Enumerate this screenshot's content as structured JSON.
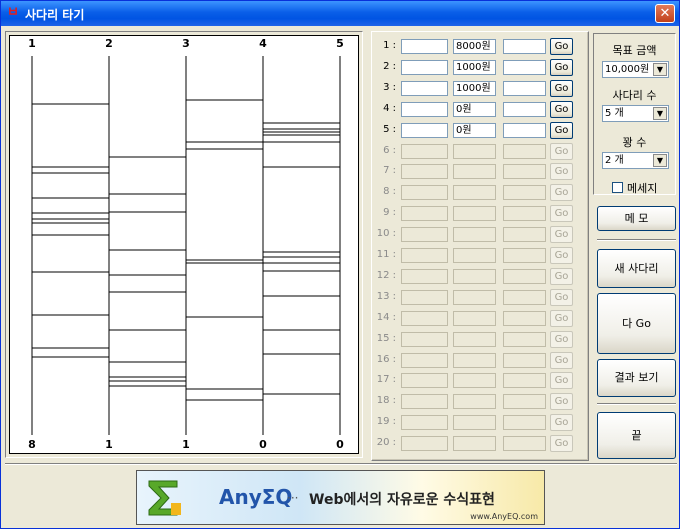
{
  "window": {
    "title": "사다리 타기",
    "title_icon": "ㅂ",
    "close_label": "✕"
  },
  "ladder": {
    "top_labels": [
      "1",
      "2",
      "3",
      "4",
      "5"
    ],
    "bottom_labels": [
      "8",
      "1",
      "1",
      "0",
      "0"
    ],
    "rungs": [
      [
        0,
        [
          102,
          165,
          171,
          196,
          211,
          217,
          221,
          233,
          270,
          313,
          346,
          355
        ]
      ],
      [
        1,
        [
          155,
          192,
          210,
          248,
          273,
          290,
          328,
          360,
          375,
          379,
          384
        ]
      ],
      [
        2,
        [
          98,
          140,
          147,
          258,
          261,
          315,
          387,
          398
        ]
      ],
      [
        3,
        [
          121,
          127,
          130,
          133,
          140,
          165,
          250,
          255,
          261,
          269,
          294,
          328,
          352,
          392
        ]
      ]
    ]
  },
  "rows": [
    {
      "num": "1 :",
      "name": "",
      "amount": "8000원",
      "result": "",
      "go": "Go",
      "enabled": true
    },
    {
      "num": "2 :",
      "name": "",
      "amount": "1000원",
      "result": "",
      "go": "Go",
      "enabled": true
    },
    {
      "num": "3 :",
      "name": "",
      "amount": "1000원",
      "result": "",
      "go": "Go",
      "enabled": true
    },
    {
      "num": "4 :",
      "name": "",
      "amount": "0원",
      "result": "",
      "go": "Go",
      "enabled": true
    },
    {
      "num": "5 :",
      "name": "",
      "amount": "0원",
      "result": "",
      "go": "Go",
      "enabled": true
    },
    {
      "num": "6 :",
      "name": "",
      "amount": "",
      "result": "",
      "go": "Go",
      "enabled": false
    },
    {
      "num": "7 :",
      "name": "",
      "amount": "",
      "result": "",
      "go": "Go",
      "enabled": false
    },
    {
      "num": "8 :",
      "name": "",
      "amount": "",
      "result": "",
      "go": "Go",
      "enabled": false
    },
    {
      "num": "9 :",
      "name": "",
      "amount": "",
      "result": "",
      "go": "Go",
      "enabled": false
    },
    {
      "num": "10 :",
      "name": "",
      "amount": "",
      "result": "",
      "go": "Go",
      "enabled": false
    },
    {
      "num": "11 :",
      "name": "",
      "amount": "",
      "result": "",
      "go": "Go",
      "enabled": false
    },
    {
      "num": "12 :",
      "name": "",
      "amount": "",
      "result": "",
      "go": "Go",
      "enabled": false
    },
    {
      "num": "13 :",
      "name": "",
      "amount": "",
      "result": "",
      "go": "Go",
      "enabled": false
    },
    {
      "num": "14 :",
      "name": "",
      "amount": "",
      "result": "",
      "go": "Go",
      "enabled": false
    },
    {
      "num": "15 :",
      "name": "",
      "amount": "",
      "result": "",
      "go": "Go",
      "enabled": false
    },
    {
      "num": "16 :",
      "name": "",
      "amount": "",
      "result": "",
      "go": "Go",
      "enabled": false
    },
    {
      "num": "17 :",
      "name": "",
      "amount": "",
      "result": "",
      "go": "Go",
      "enabled": false
    },
    {
      "num": "18 :",
      "name": "",
      "amount": "",
      "result": "",
      "go": "Go",
      "enabled": false
    },
    {
      "num": "19 :",
      "name": "",
      "amount": "",
      "result": "",
      "go": "Go",
      "enabled": false
    },
    {
      "num": "20 :",
      "name": "",
      "amount": "",
      "result": "",
      "go": "Go",
      "enabled": false
    }
  ],
  "settings": {
    "target_label": "목표 금액",
    "target_value": "10,000원",
    "ladder_count_label": "사다리 수",
    "ladder_count_value": "5 개",
    "blank_label": "꽝 수",
    "blank_value": "2 개",
    "hide_label": "메세지",
    "hide_checked": false
  },
  "buttons": {
    "memo": "메 모",
    "new_ladder": "새 사다리",
    "all_go": "다 Go",
    "show_result": "결과 보기",
    "end": "끝"
  },
  "banner": {
    "brand": "AnyΣQ",
    "dots": "···",
    "text": "Web에서의 자유로운 수식표현",
    "url": "www.AnyEQ.com"
  },
  "colors": {
    "titlebar": "#0054e3",
    "face": "#ece9d8",
    "banner_brand": "#2255aa"
  }
}
